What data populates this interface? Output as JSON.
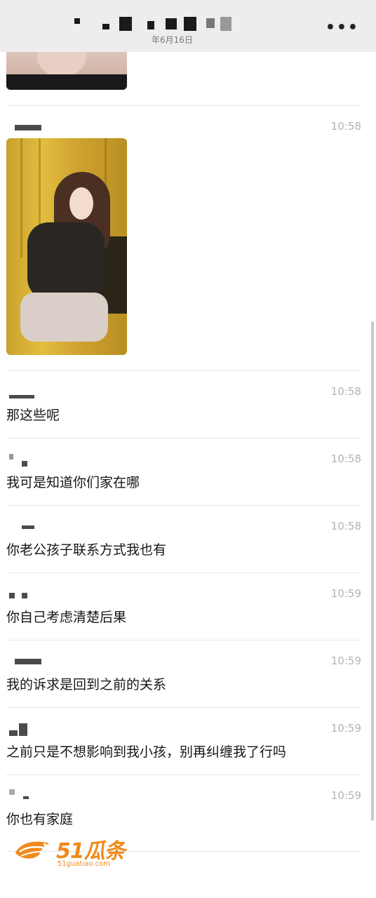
{
  "header": {
    "date_subtitle": "年6月16日",
    "more_icon": "more-icon"
  },
  "messages": [
    {
      "time": "10:58",
      "text": ""
    },
    {
      "time": "10:58",
      "text": "那这些呢"
    },
    {
      "time": "10:58",
      "text": "我可是知道你们家在哪"
    },
    {
      "time": "10:58",
      "text": "你老公孩子联系方式我也有"
    },
    {
      "time": "10:59",
      "text": "你自己考虑清楚后果"
    },
    {
      "time": "10:59",
      "text": "我的诉求是回到之前的关系"
    },
    {
      "time": "10:59",
      "text": "之前只是不想影响到我小孩，别再纠缠我了行吗"
    },
    {
      "time": "10:59",
      "text": "你也有家庭"
    }
  ],
  "watermark": {
    "brand": "51瓜条",
    "url": "51guatiao.com",
    "color": "#f08a1c"
  }
}
